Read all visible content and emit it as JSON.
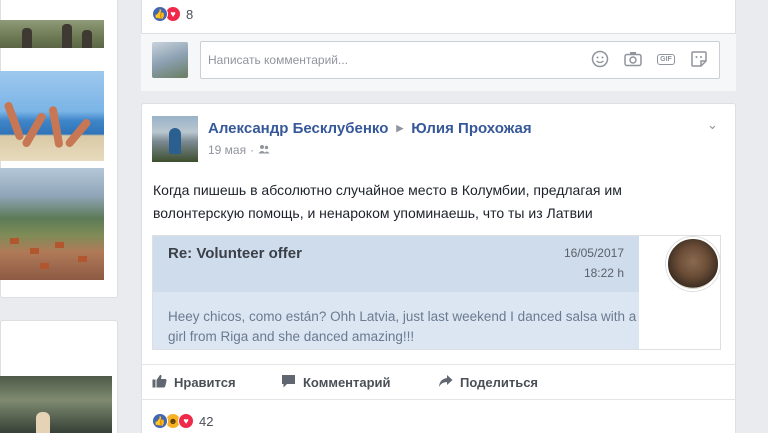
{
  "previous_post": {
    "reactions": [
      "like",
      "love"
    ],
    "reaction_count": "8",
    "comment_placeholder": "Написать комментарий...",
    "comment_icons": [
      "smiley-icon",
      "camera-icon",
      "gif-icon",
      "sticker-icon"
    ],
    "gif_label": "GIF"
  },
  "post": {
    "author": "Александр Бесклубенко",
    "recipient": "Юлия Прохожая",
    "date": "19 мая",
    "audience_icon": "friends-icon",
    "text": "Когда пишешь в абсолютно случайное место в Колумбии, предлагая им волонтерскую помощь, и ненароком упоминаешь, что ты из Латвии",
    "embed": {
      "subject": "Re: Volunteer offer",
      "date": "16/05/2017",
      "time": "18:22 h",
      "body": "Heey chicos, como están? Ohh Latvia, just last weekend I danced salsa with a girl from Riga and she danced amazing!!!"
    },
    "actions": {
      "like": "Нравится",
      "comment": "Комментарий",
      "share": "Поделиться"
    },
    "reactions": [
      "like",
      "haha",
      "love"
    ],
    "reaction_count": "42"
  },
  "colors": {
    "link": "#365899",
    "like_blue": "#4267b2",
    "love_red": "#f0284a",
    "haha_yellow": "#f7b125",
    "background": "#e9ebee"
  }
}
